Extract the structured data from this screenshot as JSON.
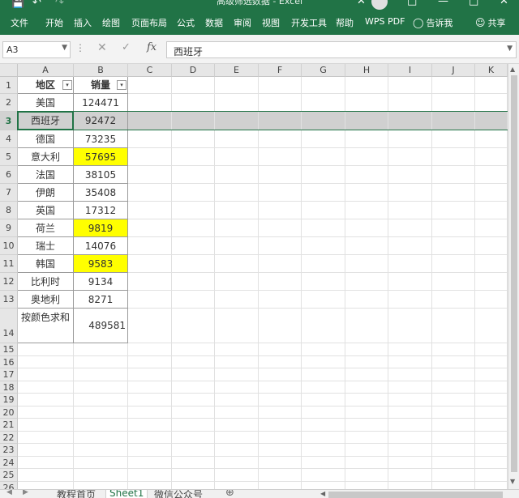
{
  "window": {
    "title": "高级筛选数据 - Excel"
  },
  "ribbon": {
    "tabs": [
      "文件",
      "开始",
      "插入",
      "绘图",
      "页面布局",
      "公式",
      "数据",
      "审阅",
      "视图",
      "开发工具",
      "帮助",
      "WPS PDF"
    ],
    "tell_me": "告诉我",
    "share": "共享"
  },
  "formula_bar": {
    "name_box": "A3",
    "content": "西班牙"
  },
  "columns": [
    "A",
    "B",
    "C",
    "D",
    "E",
    "F",
    "G",
    "H",
    "I",
    "J",
    "K"
  ],
  "headers": {
    "region": "地区",
    "sales": "销量"
  },
  "rows": [
    {
      "num": "1"
    },
    {
      "num": "2",
      "region": "美国",
      "sales": "124471"
    },
    {
      "num": "3",
      "region": "西班牙",
      "sales": "92472"
    },
    {
      "num": "4",
      "region": "德国",
      "sales": "73235"
    },
    {
      "num": "5",
      "region": "意大利",
      "sales": "57695",
      "highlight": true
    },
    {
      "num": "6",
      "region": "法国",
      "sales": "38105"
    },
    {
      "num": "7",
      "region": "伊朗",
      "sales": "35408"
    },
    {
      "num": "8",
      "region": "英国",
      "sales": "17312"
    },
    {
      "num": "9",
      "region": "荷兰",
      "sales": "9819",
      "highlight": true
    },
    {
      "num": "10",
      "region": "瑞士",
      "sales": "14076"
    },
    {
      "num": "11",
      "region": "韩国",
      "sales": "9583",
      "highlight": true
    },
    {
      "num": "12",
      "region": "比利时",
      "sales": "9134"
    },
    {
      "num": "13",
      "region": "奥地利",
      "sales": "8271"
    },
    {
      "num": "14",
      "region": "按颜色求和",
      "sales": "489581"
    }
  ],
  "empty_rows": [
    "15",
    "16",
    "17",
    "18",
    "19",
    "20",
    "21",
    "22",
    "23",
    "24",
    "25",
    "26"
  ],
  "sheets": {
    "tab1": "教程首页",
    "tab2": "Sheet1",
    "tab3": "微信公众号"
  },
  "colors": {
    "brand": "#217346",
    "highlight": "#ffff00",
    "selected_row": "#d0d0d0"
  }
}
